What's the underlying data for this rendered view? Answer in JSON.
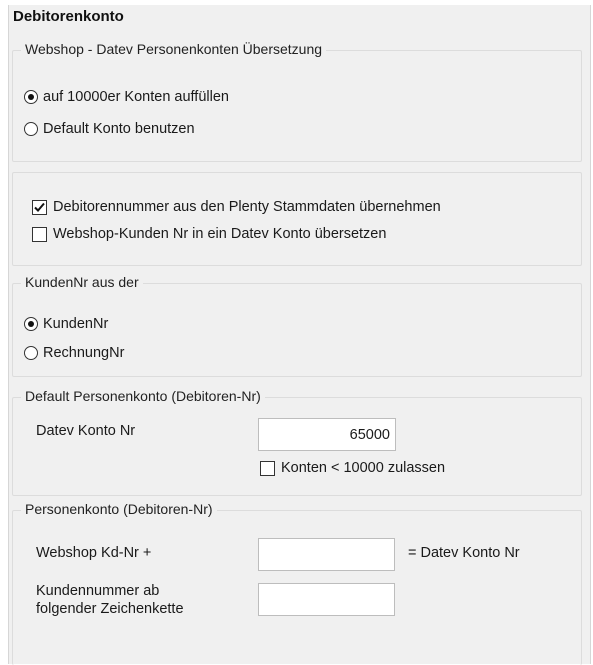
{
  "title": "Debitorenkonto",
  "group1": {
    "legend": "Webshop - Datev Personenkonten Übersetzung",
    "radio1": "auf 10000er Konten auffüllen",
    "radio2": "Default Konto benutzen"
  },
  "group2": {
    "check1": "Debitorennummer aus den Plenty Stammdaten übernehmen",
    "check2": "Webshop-Kunden Nr in ein Datev Konto übersetzen"
  },
  "group3": {
    "legend": "KundenNr aus der",
    "radio1": "KundenNr",
    "radio2": "RechnungNr"
  },
  "group4": {
    "legend": "Default Personenkonto (Debitoren-Nr)",
    "label": "Datev Konto Nr",
    "value": "65000",
    "check": "Konten < 10000 zulassen"
  },
  "group5": {
    "legend": "Personenkonto (Debitoren-Nr)",
    "label1": "Webshop Kd-Nr +",
    "suffix": "= Datev Konto Nr",
    "label2_line1": "Kundennummer ab",
    "label2_line2": "folgender Zeichenkette",
    "value1": "",
    "value2": ""
  }
}
